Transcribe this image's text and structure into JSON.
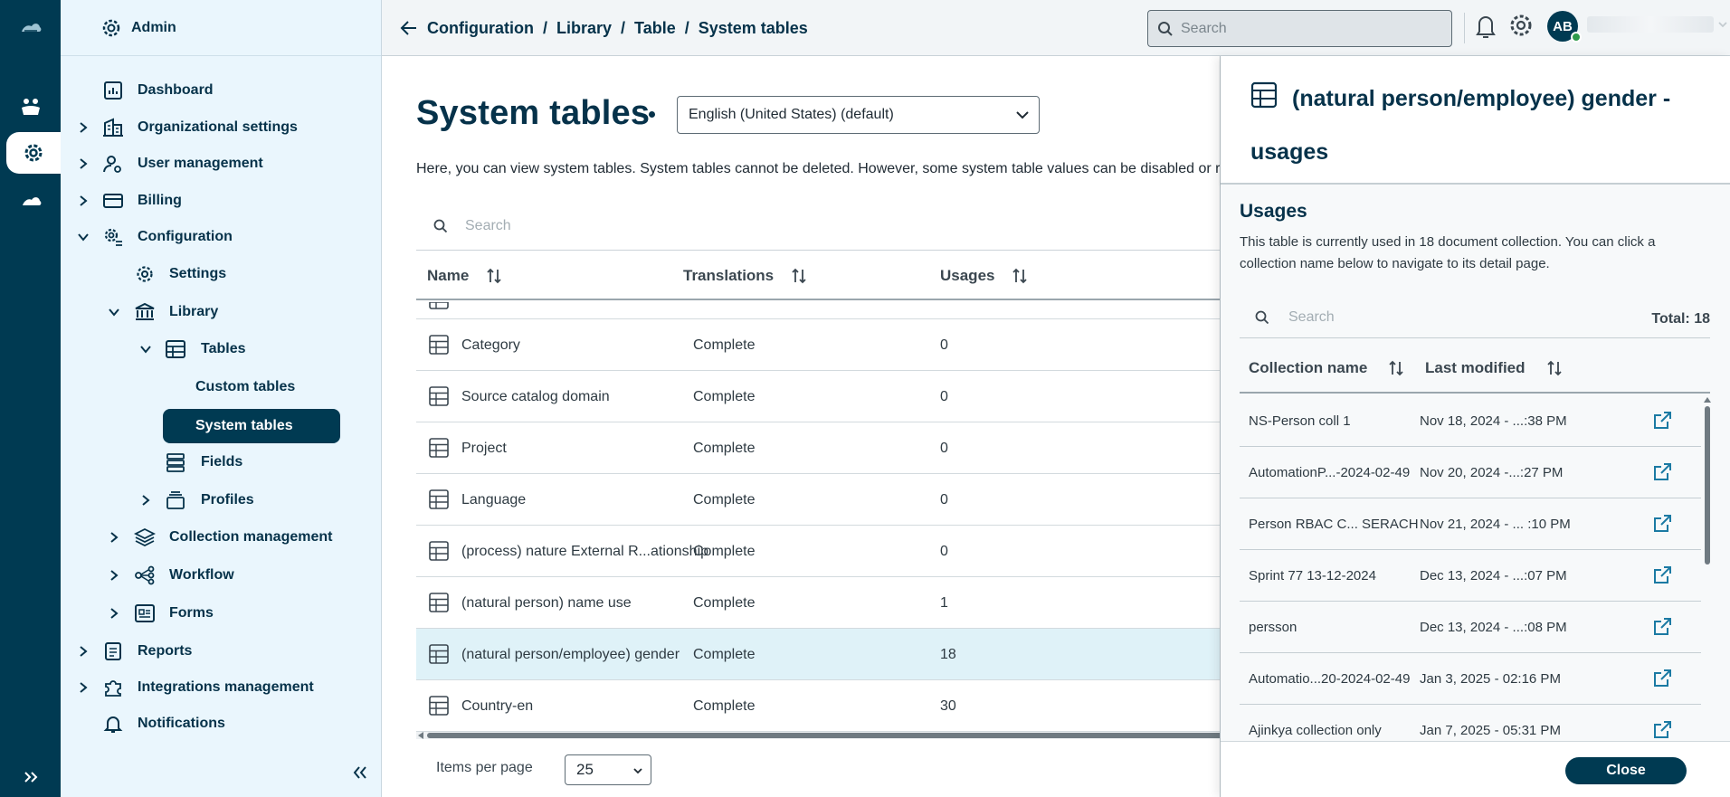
{
  "sidebar": {
    "header": "Admin",
    "items": [
      {
        "label": "Dashboard"
      },
      {
        "label": "Organizational settings"
      },
      {
        "label": "User management"
      },
      {
        "label": "Billing"
      },
      {
        "label": "Configuration"
      },
      {
        "label": "Settings"
      },
      {
        "label": "Library"
      },
      {
        "label": "Tables"
      },
      {
        "label": "Custom tables"
      },
      {
        "label": "System tables"
      },
      {
        "label": "Fields"
      },
      {
        "label": "Profiles"
      },
      {
        "label": "Collection management"
      },
      {
        "label": "Workflow"
      },
      {
        "label": "Forms"
      },
      {
        "label": "Reports"
      },
      {
        "label": "Integrations management"
      },
      {
        "label": "Notifications"
      }
    ]
  },
  "topbar": {
    "breadcrumb": [
      "Configuration",
      "Library",
      "Table",
      "System tables"
    ],
    "separator": "/",
    "search_placeholder": "Search",
    "avatar_initials": "AB"
  },
  "main": {
    "title": "System tables",
    "language": "English (United States) (default)",
    "description": "Here, you can view system tables. System tables cannot be deleted. However, some system table values can be disabled or re",
    "search_placeholder": "Search",
    "columns": [
      "Name",
      "Translations",
      "Usages"
    ],
    "rows": [
      {
        "name": "Category",
        "translations": "Complete",
        "usages": "0"
      },
      {
        "name": "Source catalog domain",
        "translations": "Complete",
        "usages": "0"
      },
      {
        "name": "Project",
        "translations": "Complete",
        "usages": "0"
      },
      {
        "name": "Language",
        "translations": "Complete",
        "usages": "0"
      },
      {
        "name": "(process) nature External R...ationship",
        "translations": "Complete",
        "usages": "0"
      },
      {
        "name": "(natural person) name use",
        "translations": "Complete",
        "usages": "1"
      },
      {
        "name": "(natural person/employee) gender",
        "translations": "Complete",
        "usages": "18"
      },
      {
        "name": "Country-en",
        "translations": "Complete",
        "usages": "30"
      }
    ],
    "items_per_page_label": "Items per page",
    "items_per_page": "25"
  },
  "panel": {
    "title": "(natural person/employee) gender - usages",
    "section_title": "Usages",
    "description": "This table is currently used in 18 document collection. You can click a collection name below to navigate to its detail page.",
    "search_placeholder": "Search",
    "total": "Total: 18",
    "columns": [
      "Collection name",
      "Last modified"
    ],
    "rows": [
      {
        "name": "NS-Person coll 1",
        "modified": "Nov 18, 2024 - ...:38 PM"
      },
      {
        "name": "AutomationP...-2024-02-49",
        "modified": "Nov 20, 2024 -...:27 PM"
      },
      {
        "name": "Person RBAC C...  SERACH",
        "modified": "Nov 21, 2024 - ... :10 PM"
      },
      {
        "name": "Sprint 77 13-12-2024",
        "modified": "Dec 13, 2024 - ...:07 PM"
      },
      {
        "name": "persson",
        "modified": "Dec 13, 2024 - ...:08 PM"
      },
      {
        "name": "Automatio...20-2024-02-49",
        "modified": "Jan 3, 2025 - 02:16 PM"
      },
      {
        "name": "Ajinkya collection only",
        "modified": "Jan 7, 2025 - 05:31 PM"
      }
    ],
    "close_label": "Close"
  },
  "colors": {
    "brand_dark": "#003a52",
    "sidebar_bg": "#eaf6fd",
    "row_highlight": "#dff2f8",
    "status_online": "#2e9a4a"
  }
}
